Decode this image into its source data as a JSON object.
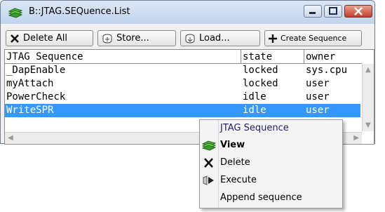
{
  "window": {
    "title": "B::JTAG.SEQuence.List",
    "controls": {
      "minimize": "minimize",
      "maximize": "maximize",
      "close": "close"
    }
  },
  "toolbar": {
    "delete_all": "Delete All",
    "store": "Store...",
    "load": "Load...",
    "create_sequence": "Create Sequence"
  },
  "table": {
    "columns": [
      "JTAG Sequence",
      "state",
      "owner"
    ],
    "rows": [
      {
        "name": "_DapEnable",
        "state": "locked",
        "owner": "sys.cpu"
      },
      {
        "name": "myAttach",
        "state": "locked",
        "owner": "user"
      },
      {
        "name": "PowerCheck",
        "state": "idle",
        "owner": "user"
      },
      {
        "name": "WriteSPR",
        "state": "idle",
        "owner": "user",
        "selected": true
      }
    ]
  },
  "context_menu": {
    "header": "JTAG Sequence",
    "items": [
      {
        "label": "View",
        "icon": "view-icon",
        "bold": true
      },
      {
        "label": "Delete",
        "icon": "delete-x-icon"
      },
      {
        "label": "Execute",
        "icon": "execute-icon"
      },
      {
        "label": "Append sequence",
        "icon": ""
      }
    ]
  },
  "colors": {
    "selection": "#3399ff",
    "menu_header": "#22206a"
  }
}
